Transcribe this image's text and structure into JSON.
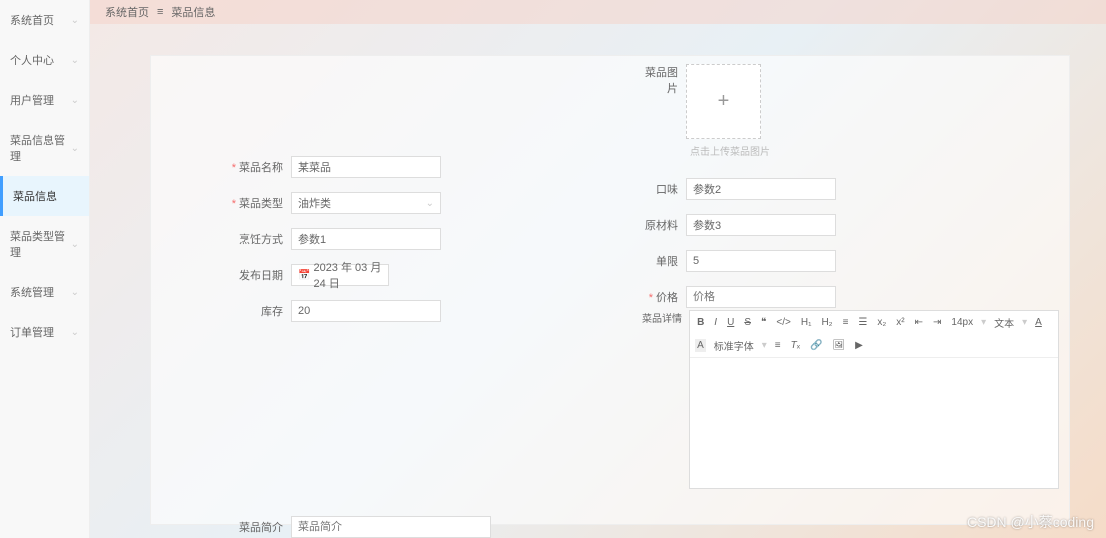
{
  "sidebar": {
    "items": [
      {
        "label": "系统首页"
      },
      {
        "label": "个人中心"
      },
      {
        "label": "用户管理"
      },
      {
        "label": "菜品信息管理"
      },
      {
        "label": "菜品信息"
      },
      {
        "label": "菜品类型管理"
      },
      {
        "label": "系统管理"
      },
      {
        "label": "订单管理"
      }
    ]
  },
  "breadcrumb": {
    "root": "系统首页",
    "page": "菜品信息"
  },
  "upload": {
    "label": "菜品图片",
    "hint": "点击上传菜品图片"
  },
  "form": {
    "name": {
      "label": "菜品名称",
      "value": "某菜品"
    },
    "type": {
      "label": "菜品类型",
      "value": "油炸类"
    },
    "cook": {
      "label": "烹饪方式",
      "value": "参数1"
    },
    "date": {
      "label": "发布日期",
      "value": "2023 年 03 月 24 日"
    },
    "stock": {
      "label": "库存",
      "value": "20"
    },
    "taste": {
      "label": "口味",
      "value": "参数2"
    },
    "material": {
      "label": "原材料",
      "value": "参数3"
    },
    "limit": {
      "label": "单限",
      "value": "5"
    },
    "price": {
      "label": "价格",
      "placeholder": "价格"
    },
    "detail_label": "菜品详情",
    "intro": {
      "label": "菜品简介",
      "placeholder": "菜品简介"
    }
  },
  "editor": {
    "fontsize": "14px",
    "t_text": "文本",
    "t_font": "标准字体"
  },
  "watermark": "CSDN @小蔡coding"
}
